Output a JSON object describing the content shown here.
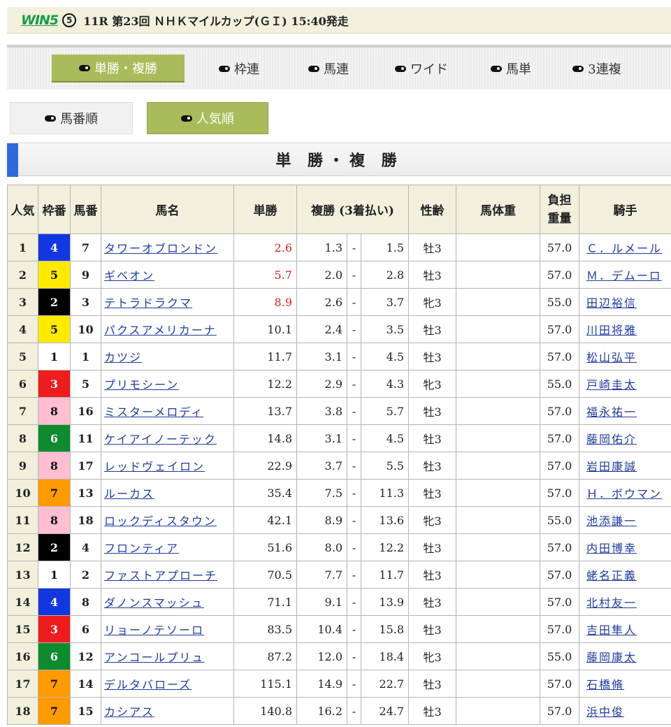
{
  "race_header": {
    "logo": "WIN5",
    "leg": "⑤",
    "title": "11R 第23回 ＮＨＫマイルカップ(ＧＩ) 15:40発走"
  },
  "bet_tabs": [
    {
      "label": "単勝・複勝",
      "active": true
    },
    {
      "label": "枠連",
      "active": false
    },
    {
      "label": "馬連",
      "active": false
    },
    {
      "label": "ワイド",
      "active": false
    },
    {
      "label": "馬単",
      "active": false
    },
    {
      "label": "3連複",
      "active": false
    }
  ],
  "sort_buttons": [
    {
      "label": "馬番順",
      "active": false
    },
    {
      "label": "人気順",
      "active": true
    }
  ],
  "section_title": "単 勝・複 勝",
  "table": {
    "headers": {
      "ninki": "人気",
      "waku": "枠番",
      "umaban": "馬番",
      "name": "馬名",
      "tansho": "単勝",
      "fukusho": "複勝 (3着払い)",
      "seirei": "性齢",
      "bataiju": "馬体重",
      "kinryo": "負担\n重量",
      "jockey": "騎手"
    },
    "rows": [
      {
        "ninki": "1",
        "waku": "4",
        "umaban": "7",
        "name": "タワーオブロンドン",
        "tansho": "2.6",
        "fuku_min": "1.3",
        "fuku_max": "1.5",
        "seirei": "牡3",
        "kinryo": "57.0",
        "jockey": "Ｃ．ルメール",
        "highlight": true
      },
      {
        "ninki": "2",
        "waku": "5",
        "umaban": "9",
        "name": "ギベオン",
        "tansho": "5.7",
        "fuku_min": "2.0",
        "fuku_max": "2.8",
        "seirei": "牡3",
        "kinryo": "57.0",
        "jockey": "Ｍ．デムーロ",
        "highlight": true
      },
      {
        "ninki": "3",
        "waku": "2",
        "umaban": "3",
        "name": "テトラドラクマ",
        "tansho": "8.9",
        "fuku_min": "2.6",
        "fuku_max": "3.7",
        "seirei": "牝3",
        "kinryo": "55.0",
        "jockey": "田辺裕信",
        "highlight": true
      },
      {
        "ninki": "4",
        "waku": "5",
        "umaban": "10",
        "name": "パクスアメリカーナ",
        "tansho": "10.1",
        "fuku_min": "2.4",
        "fuku_max": "3.5",
        "seirei": "牡3",
        "kinryo": "57.0",
        "jockey": "川田将雅",
        "highlight": false
      },
      {
        "ninki": "5",
        "waku": "1",
        "umaban": "1",
        "name": "カツジ",
        "tansho": "11.7",
        "fuku_min": "3.1",
        "fuku_max": "4.5",
        "seirei": "牡3",
        "kinryo": "57.0",
        "jockey": "松山弘平",
        "highlight": false
      },
      {
        "ninki": "6",
        "waku": "3",
        "umaban": "5",
        "name": "プリモシーン",
        "tansho": "12.2",
        "fuku_min": "2.9",
        "fuku_max": "4.3",
        "seirei": "牝3",
        "kinryo": "55.0",
        "jockey": "戸崎圭太",
        "highlight": false
      },
      {
        "ninki": "7",
        "waku": "8",
        "umaban": "16",
        "name": "ミスターメロディ",
        "tansho": "13.7",
        "fuku_min": "3.8",
        "fuku_max": "5.7",
        "seirei": "牡3",
        "kinryo": "57.0",
        "jockey": "福永祐一",
        "highlight": false
      },
      {
        "ninki": "8",
        "waku": "6",
        "umaban": "11",
        "name": "ケイアイノーテック",
        "tansho": "14.8",
        "fuku_min": "3.1",
        "fuku_max": "4.5",
        "seirei": "牡3",
        "kinryo": "57.0",
        "jockey": "藤岡佑介",
        "highlight": false
      },
      {
        "ninki": "9",
        "waku": "8",
        "umaban": "17",
        "name": "レッドヴェイロン",
        "tansho": "22.9",
        "fuku_min": "3.7",
        "fuku_max": "5.5",
        "seirei": "牡3",
        "kinryo": "57.0",
        "jockey": "岩田康誠",
        "highlight": false
      },
      {
        "ninki": "10",
        "waku": "7",
        "umaban": "13",
        "name": "ルーカス",
        "tansho": "35.4",
        "fuku_min": "7.5",
        "fuku_max": "11.3",
        "seirei": "牡3",
        "kinryo": "57.0",
        "jockey": "Ｈ．ボウマン",
        "highlight": false
      },
      {
        "ninki": "11",
        "waku": "8",
        "umaban": "18",
        "name": "ロックディスタウン",
        "tansho": "42.1",
        "fuku_min": "8.9",
        "fuku_max": "13.6",
        "seirei": "牝3",
        "kinryo": "55.0",
        "jockey": "池添謙一",
        "highlight": false
      },
      {
        "ninki": "12",
        "waku": "2",
        "umaban": "4",
        "name": "フロンティア",
        "tansho": "51.6",
        "fuku_min": "8.0",
        "fuku_max": "12.2",
        "seirei": "牡3",
        "kinryo": "57.0",
        "jockey": "内田博幸",
        "highlight": false
      },
      {
        "ninki": "13",
        "waku": "1",
        "umaban": "2",
        "name": "ファストアプローチ",
        "tansho": "70.5",
        "fuku_min": "7.7",
        "fuku_max": "11.7",
        "seirei": "牡3",
        "kinryo": "57.0",
        "jockey": "蛯名正義",
        "highlight": false
      },
      {
        "ninki": "14",
        "waku": "4",
        "umaban": "8",
        "name": "ダノンスマッシュ",
        "tansho": "71.1",
        "fuku_min": "9.1",
        "fuku_max": "13.9",
        "seirei": "牡3",
        "kinryo": "57.0",
        "jockey": "北村友一",
        "highlight": false
      },
      {
        "ninki": "15",
        "waku": "3",
        "umaban": "6",
        "name": "リョーノテソーロ",
        "tansho": "83.5",
        "fuku_min": "10.4",
        "fuku_max": "15.8",
        "seirei": "牡3",
        "kinryo": "57.0",
        "jockey": "吉田隼人",
        "highlight": false
      },
      {
        "ninki": "16",
        "waku": "6",
        "umaban": "12",
        "name": "アンコールプリュ",
        "tansho": "87.2",
        "fuku_min": "12.0",
        "fuku_max": "18.4",
        "seirei": "牝3",
        "kinryo": "55.0",
        "jockey": "藤岡康太",
        "highlight": false
      },
      {
        "ninki": "17",
        "waku": "7",
        "umaban": "14",
        "name": "デルタバローズ",
        "tansho": "115.1",
        "fuku_min": "14.9",
        "fuku_max": "22.7",
        "seirei": "牡3",
        "kinryo": "57.0",
        "jockey": "石橋脩",
        "highlight": false
      },
      {
        "ninki": "18",
        "waku": "7",
        "umaban": "15",
        "name": "カシアス",
        "tansho": "140.8",
        "fuku_min": "16.2",
        "fuku_max": "24.7",
        "seirei": "牡3",
        "kinryo": "57.0",
        "jockey": "浜中俊",
        "highlight": false
      }
    ]
  },
  "colors": {
    "accent_green": "#a9bb5a",
    "header_beige": "#f2f0dd",
    "link_blue": "#1f3b9c",
    "favorite_red": "#d12020",
    "section_bar_blue": "#2f6bd8"
  }
}
